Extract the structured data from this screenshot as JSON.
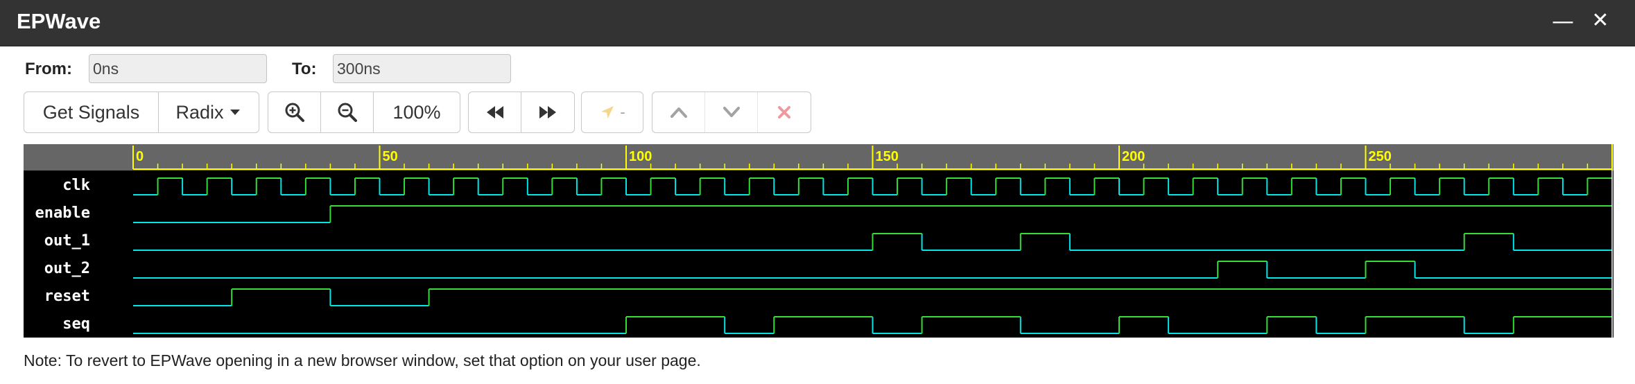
{
  "window": {
    "title": "EPWave",
    "minimize_icon": "minimize-icon",
    "close_icon": "close-icon"
  },
  "range": {
    "from_label": "From:",
    "from_value": "0ns",
    "to_label": "To:",
    "to_value": "300ns"
  },
  "toolbar": {
    "get_signals_label": "Get Signals",
    "radix_label": "Radix",
    "radix_icon": "caret-down-icon",
    "zoom_in_icon": "zoom-in-icon",
    "zoom_out_icon": "zoom-out-icon",
    "zoom_level": "100%",
    "rewind_icon": "rewind-icon",
    "fast_forward_icon": "fast-forward-icon",
    "cursor_icon": "cursor-arrow-icon",
    "cursor_value": "-",
    "move_up_icon": "chevron-up-icon",
    "move_down_icon": "chevron-down-icon",
    "remove_icon": "remove-x-icon"
  },
  "waveform": {
    "time_range_ns": [
      0,
      300
    ],
    "axis_labels": [
      "0",
      "50",
      "100",
      "150",
      "200",
      "250"
    ],
    "colors": {
      "background": "#000000",
      "ruler_background": "#666666",
      "ruler_line": "#ffff00",
      "signal_low": "#00e5e5",
      "signal_high": "#33dd33",
      "signal_name": "#ffffff"
    },
    "signals": [
      {
        "name": "clk",
        "clock_period_ns": 10,
        "first_rising_ns": 5
      },
      {
        "name": "enable",
        "transitions": [
          [
            0,
            0
          ],
          [
            40,
            1
          ]
        ]
      },
      {
        "name": "out_1",
        "transitions": [
          [
            0,
            0
          ],
          [
            150,
            1
          ],
          [
            160,
            0
          ],
          [
            180,
            1
          ],
          [
            190,
            0
          ],
          [
            270,
            1
          ],
          [
            280,
            0
          ]
        ]
      },
      {
        "name": "out_2",
        "transitions": [
          [
            0,
            0
          ],
          [
            220,
            1
          ],
          [
            230,
            0
          ],
          [
            250,
            1
          ],
          [
            260,
            0
          ]
        ]
      },
      {
        "name": "reset",
        "transitions": [
          [
            0,
            0
          ],
          [
            20,
            1
          ],
          [
            40,
            0
          ],
          [
            60,
            1
          ]
        ]
      },
      {
        "name": "seq",
        "transitions": [
          [
            0,
            0
          ],
          [
            100,
            1
          ],
          [
            120,
            0
          ],
          [
            130,
            1
          ],
          [
            150,
            0
          ],
          [
            160,
            1
          ],
          [
            180,
            0
          ],
          [
            200,
            1
          ],
          [
            210,
            0
          ],
          [
            230,
            1
          ],
          [
            240,
            0
          ],
          [
            250,
            1
          ],
          [
            270,
            0
          ],
          [
            280,
            1
          ]
        ]
      }
    ]
  },
  "note": "Note: To revert to EPWave opening in a new browser window, set that option on your user page."
}
